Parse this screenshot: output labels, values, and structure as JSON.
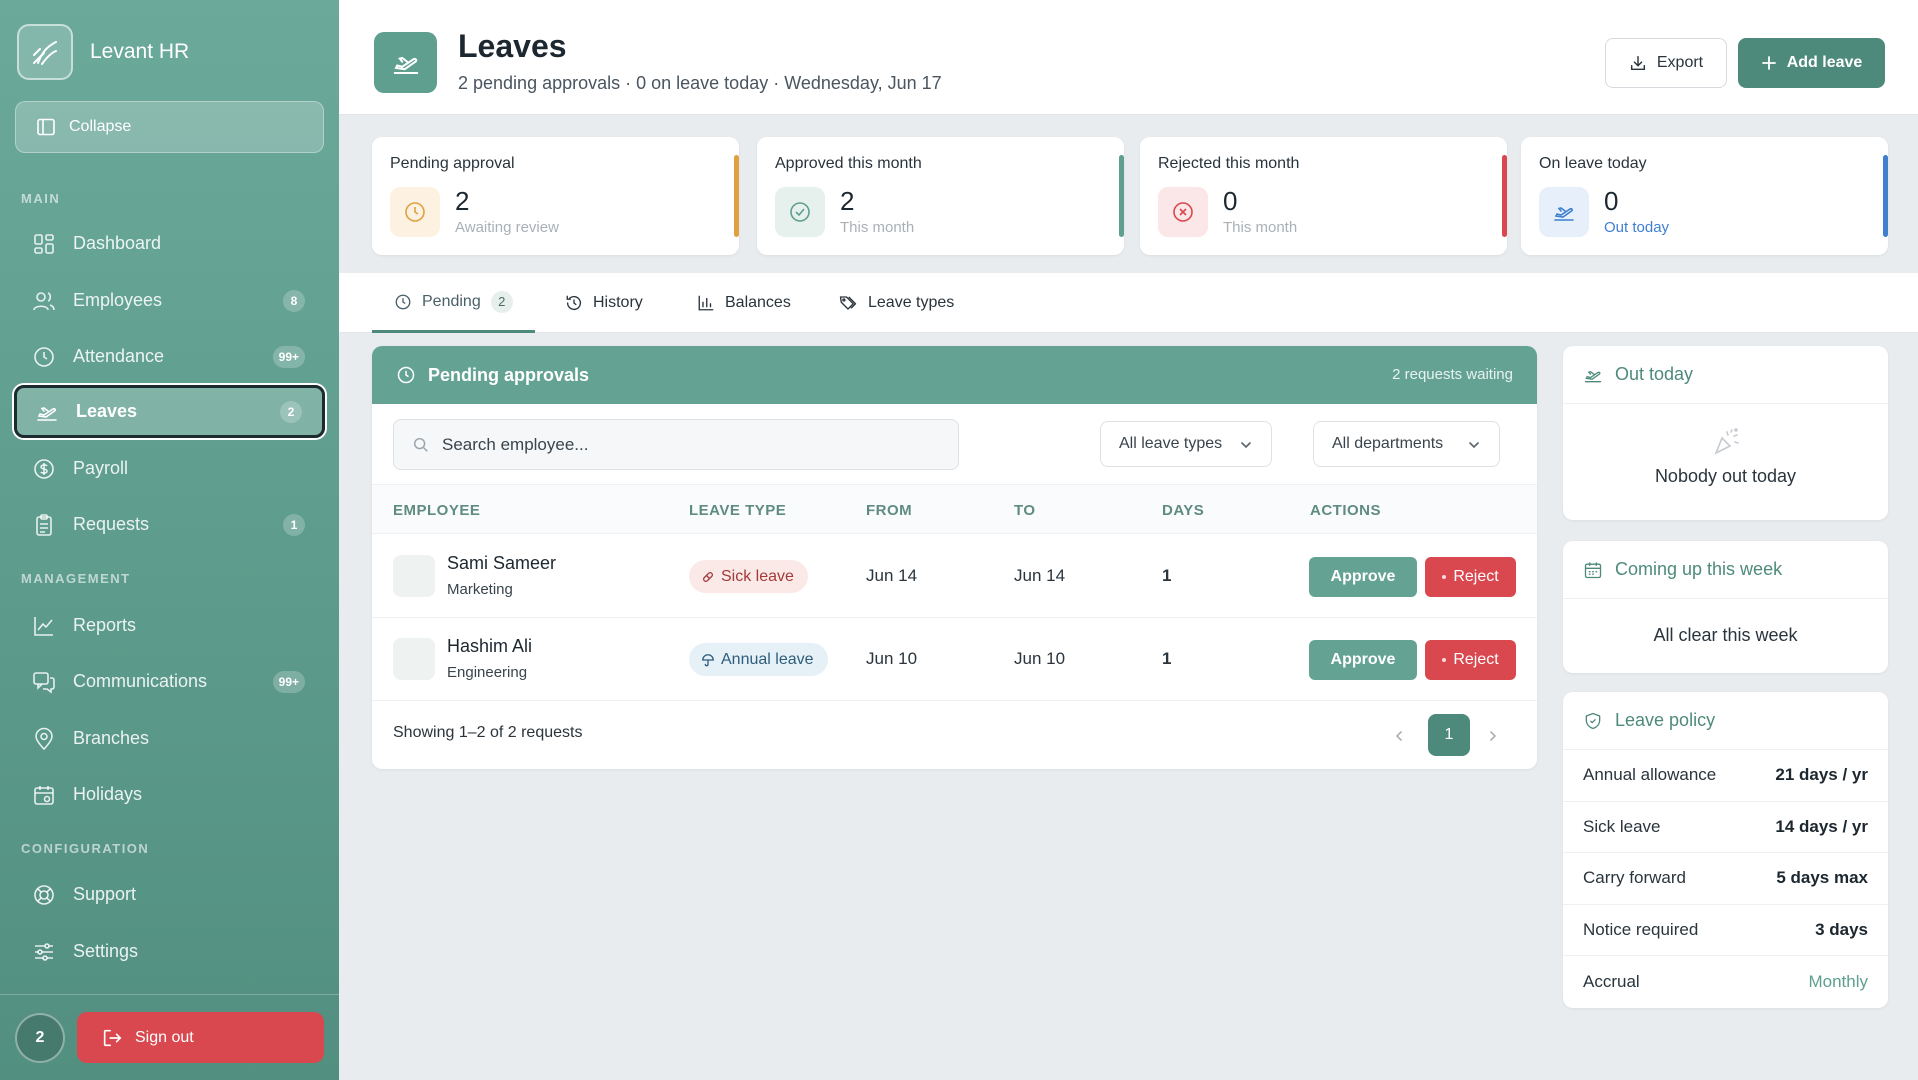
{
  "brand": {
    "name": "Levant HR"
  },
  "sidebar": {
    "collapse_label": "Collapse",
    "sections": {
      "main": "MAIN",
      "management": "MANAGEMENT",
      "configuration": "CONFIGURATION"
    },
    "items": [
      {
        "label": "Dashboard",
        "icon": "dashboard-icon",
        "badge": ""
      },
      {
        "label": "Employees",
        "icon": "users-icon",
        "badge": "8"
      },
      {
        "label": "Attendance",
        "icon": "clock-icon",
        "badge": "99+"
      },
      {
        "label": "Leaves",
        "icon": "plane-icon",
        "badge": "2",
        "active": true
      },
      {
        "label": "Payroll",
        "icon": "dollar-icon",
        "badge": ""
      },
      {
        "label": "Requests",
        "icon": "clipboard-icon",
        "badge": "1"
      },
      {
        "label": "Reports",
        "icon": "chart-line-icon",
        "badge": ""
      },
      {
        "label": "Communications",
        "icon": "chat-icon",
        "badge": "99+"
      },
      {
        "label": "Branches",
        "icon": "map-pin-icon",
        "badge": ""
      },
      {
        "label": "Holidays",
        "icon": "calendar-icon",
        "badge": ""
      },
      {
        "label": "Support",
        "icon": "lifebuoy-icon",
        "badge": ""
      },
      {
        "label": "Settings",
        "icon": "sliders-icon",
        "badge": ""
      }
    ],
    "footer": {
      "avatar_text": "2",
      "signout_label": "Sign out"
    }
  },
  "header": {
    "title": "Leaves",
    "subtitle": "2 pending approvals · 0 on leave today · Wednesday, Jun 17",
    "export_label": "Export",
    "add_label": "Add leave"
  },
  "stats": [
    {
      "label": "Pending approval",
      "value": "2",
      "sub": "Awaiting review",
      "accent": "#e0a040",
      "icon": "clock-icon"
    },
    {
      "label": "Approved this month",
      "value": "2",
      "sub": "This month",
      "accent": "#5f9f8f",
      "icon": "check-circle-icon"
    },
    {
      "label": "Rejected this month",
      "value": "0",
      "sub": "This month",
      "accent": "#d9474f",
      "icon": "x-circle-icon"
    },
    {
      "label": "On leave today",
      "value": "0",
      "sub": "Out today",
      "accent": "#3f7fd0",
      "icon": "plane-icon"
    }
  ],
  "tabs": [
    {
      "label": "Pending",
      "count": "2",
      "active": true
    },
    {
      "label": "History"
    },
    {
      "label": "Balances"
    },
    {
      "label": "Leave types"
    }
  ],
  "pending": {
    "title": "Pending approvals",
    "meta": "2 requests waiting",
    "search_placeholder": "Search employee...",
    "filter_types": "All leave types",
    "filter_depts": "All departments",
    "columns": [
      "EMPLOYEE",
      "LEAVE TYPE",
      "FROM",
      "TO",
      "DAYS",
      "ACTIONS"
    ],
    "rows": [
      {
        "name": "Sami Sameer",
        "dept": "Marketing",
        "type": "Sick leave",
        "from": "Jun 14",
        "to": "Jun 14",
        "days": "1"
      },
      {
        "name": "Hashim Ali",
        "dept": "Engineering",
        "type": "Annual leave",
        "from": "Jun 10",
        "to": "Jun 10",
        "days": "1"
      }
    ],
    "approve_label": "Approve",
    "reject_label": "Reject",
    "showing": "Showing 1–2 of 2 requests",
    "page": "1"
  },
  "out_today": {
    "title": "Out today",
    "empty": "Nobody out today"
  },
  "coming_up": {
    "title": "Coming up this week",
    "empty": "All clear this week"
  },
  "policy": {
    "title": "Leave policy",
    "rows": [
      {
        "label": "Annual allowance",
        "value": "21 days / yr"
      },
      {
        "label": "Sick leave",
        "value": "14 days / yr"
      },
      {
        "label": "Carry forward",
        "value": "5 days max"
      },
      {
        "label": "Notice required",
        "value": "3 days"
      },
      {
        "label": "Accrual",
        "value": "Monthly"
      }
    ]
  }
}
